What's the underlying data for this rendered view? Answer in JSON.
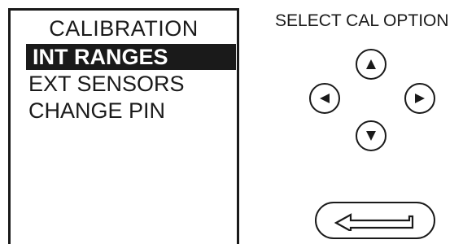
{
  "screen": {
    "title": "CALIBRATION",
    "menu": [
      {
        "label": "INT RANGES",
        "selected": true
      },
      {
        "label": "EXT SENSORS",
        "selected": false
      },
      {
        "label": "CHANGE  PIN",
        "selected": false
      }
    ]
  },
  "keypad": {
    "instruction": "SELECT CAL OPTION",
    "buttons": [
      {
        "name": "up-button",
        "icon": "triangle-up-icon"
      },
      {
        "name": "left-button",
        "icon": "triangle-left-icon"
      },
      {
        "name": "right-button",
        "icon": "triangle-right-icon"
      },
      {
        "name": "down-button",
        "icon": "triangle-down-icon"
      }
    ],
    "enter": {
      "name": "enter-button",
      "icon": "enter-arrow-icon"
    }
  },
  "colors": {
    "ink": "#1a1a1a",
    "background": "#ffffff",
    "highlight_text": "#ffffff"
  }
}
